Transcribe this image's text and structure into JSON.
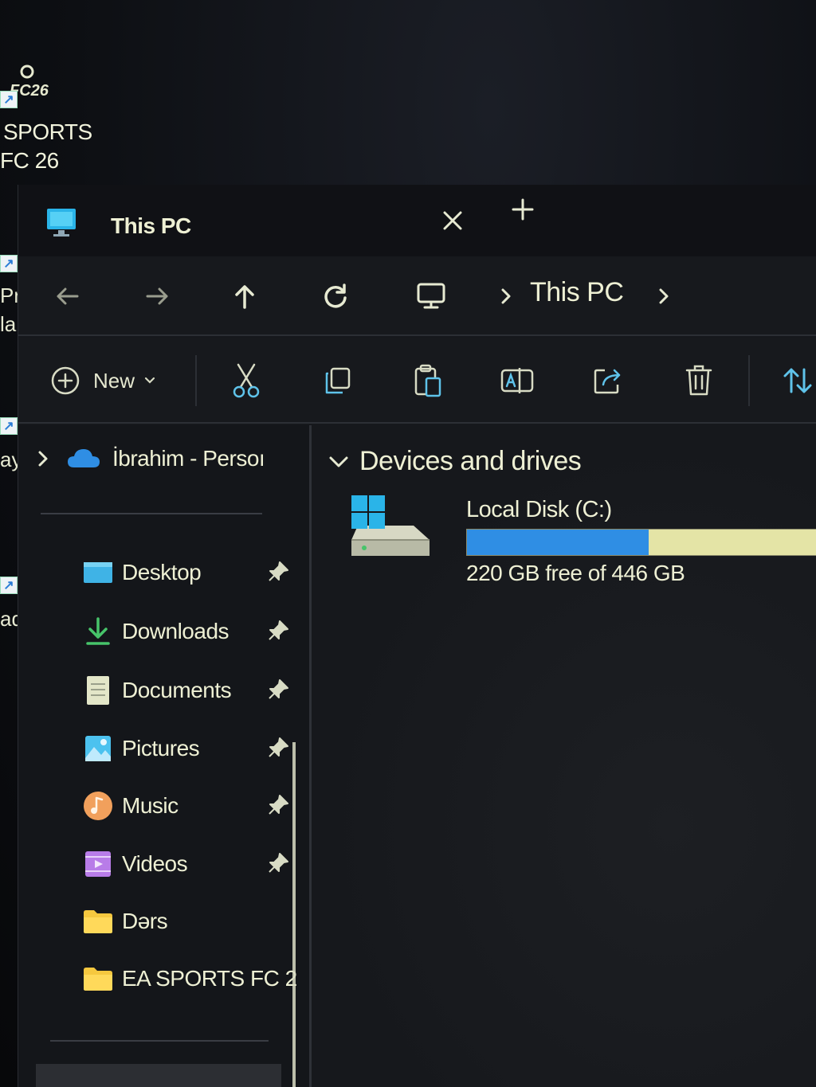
{
  "desktop": {
    "shortcut_line1": "SPORTS",
    "shortcut_line2": "FC 26",
    "logo_text": "FC26",
    "edge_labels": [
      "Pr",
      "la",
      "ay",
      "ad"
    ]
  },
  "window": {
    "tab_title": "This PC",
    "tab_close_icon": "close-icon",
    "new_tab_icon": "plus-icon"
  },
  "navigation": {
    "back_icon": "arrow-left-icon",
    "forward_icon": "arrow-right-icon",
    "up_icon": "arrow-up-icon",
    "refresh_icon": "refresh-icon",
    "breadcrumb": [
      "This PC"
    ]
  },
  "toolbar": {
    "new_label": "New",
    "actions": [
      "cut",
      "copy",
      "paste",
      "rename",
      "share",
      "delete",
      "sort"
    ]
  },
  "sidebar": {
    "onedrive_label": "İbrahim - Persoı",
    "items": [
      {
        "label": "Desktop",
        "icon": "desktop-folder-icon",
        "pinned": true
      },
      {
        "label": "Downloads",
        "icon": "download-icon",
        "pinned": true
      },
      {
        "label": "Documents",
        "icon": "documents-icon",
        "pinned": true
      },
      {
        "label": "Pictures",
        "icon": "pictures-icon",
        "pinned": true
      },
      {
        "label": "Music",
        "icon": "music-icon",
        "pinned": true
      },
      {
        "label": "Videos",
        "icon": "videos-icon",
        "pinned": true
      },
      {
        "label": "Dərs",
        "icon": "folder-icon",
        "pinned": false
      },
      {
        "label": "EA SPORTS FC 2",
        "icon": "folder-icon",
        "pinned": false
      }
    ]
  },
  "content": {
    "group_title": "Devices and drives",
    "drive": {
      "name": "Local Disk (C:)",
      "free_text": "220 GB free of 446 GB",
      "used_fraction": 0.507,
      "bar_used_color": "#2f8ee4",
      "bar_free_color": "#e4e4a6"
    }
  }
}
